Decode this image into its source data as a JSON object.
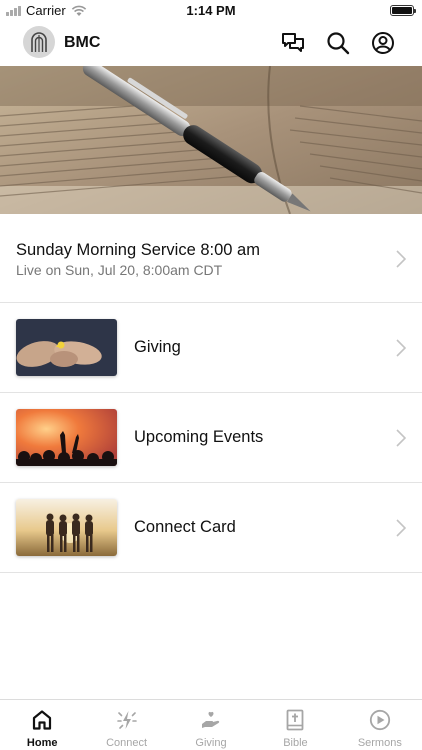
{
  "status_bar": {
    "carrier": "Carrier",
    "time": "1:14 PM",
    "battery_level": 1.0
  },
  "header": {
    "app_name": "BMC",
    "icons": [
      "chat-icon",
      "search-icon",
      "profile-icon"
    ]
  },
  "service": {
    "title": "Sunday Morning Service 8:00 am",
    "subtitle": "Live on Sun, Jul 20, 8:00am CDT"
  },
  "rows": [
    {
      "label": "Giving"
    },
    {
      "label": "Upcoming Events"
    },
    {
      "label": "Connect Card"
    }
  ],
  "tabs": [
    {
      "label": "Home",
      "icon": "home-icon",
      "active": true
    },
    {
      "label": "Connect",
      "icon": "connect-icon",
      "active": false
    },
    {
      "label": "Giving",
      "icon": "giving-icon",
      "active": false
    },
    {
      "label": "Bible",
      "icon": "bible-icon",
      "active": false
    },
    {
      "label": "Sermons",
      "icon": "play-icon",
      "active": false
    }
  ],
  "colors": {
    "active_tab": "#111111",
    "inactive_tab": "#a6a6a6",
    "subtitle": "#777777",
    "divider": "#e3e3e3"
  }
}
